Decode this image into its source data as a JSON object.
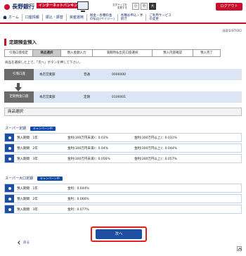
{
  "header": {
    "bank_name": "長野銀行",
    "ib_badge": "インターネットバンキング",
    "font_size_label": "文字サイズを\n変更する",
    "font_sizes": [
      "小",
      "中",
      "大"
    ],
    "logout_label": "ログアウト"
  },
  "gnav": {
    "items": [
      {
        "label": "ホーム"
      },
      {
        "label": "口座情報"
      },
      {
        "label": "振込・振替"
      },
      {
        "label": "資産運用"
      },
      {
        "label": "税金・各種料金\nの払込(ペイジー)"
      },
      {
        "label": "各種お申込・手\n続き"
      },
      {
        "label": "ご利用サービス\nの変更"
      }
    ]
  },
  "screen_id": "画面ID:BTI002",
  "page_title": "定期預金預入",
  "steps": [
    "引落口座指定",
    "商品選択",
    "預入金額入力",
    "満期時払出先口座選択",
    "預入内容確認",
    "預入完了"
  ],
  "instruction": "商品を選択した上で、「次へ」ボタンを押して下さい。",
  "withdrawal": {
    "label": "引落口座",
    "branch": "本店営業部",
    "type": "普通",
    "number": "0000000"
  },
  "deposit": {
    "label": "定期預金口座",
    "branch": "本店営業部",
    "type": "定期",
    "number": "0100001"
  },
  "section_title": "商品選択",
  "super_teiki": {
    "label": "スーパー定期",
    "campaign": "キャンペーン中",
    "rows": [
      {
        "term": "預入期間　1年",
        "rate_a": "金利(300万円未満)：0.03%",
        "rate_b": "金利(300万円以上)：0.031%"
      },
      {
        "term": "預入期間　2年",
        "rate_a": "金利(300万円未満)：0.04%",
        "rate_b": "金利(300万円以上)：0.044%"
      },
      {
        "term": "預入期間　3年",
        "rate_a": "金利(300万円未満)：0.056%",
        "rate_b": "金利(300万円以上)：0.057%"
      }
    ]
  },
  "super_large": {
    "label": "スーパー大口定期",
    "campaign": "キャンペーン中",
    "rows": [
      {
        "term": "預入期間　1年",
        "rate": "金利：0.044%"
      },
      {
        "term": "預入期間　2年",
        "rate": "金利：0.066%"
      },
      {
        "term": "預入期間　3年",
        "rate": "金利：0.077%"
      }
    ]
  },
  "next_label": "次へ",
  "back_label": "戻る",
  "colors": {
    "brand_red": "#c8102e",
    "navy": "#1a2f6b",
    "accent_blue": "#1e4fa0"
  }
}
